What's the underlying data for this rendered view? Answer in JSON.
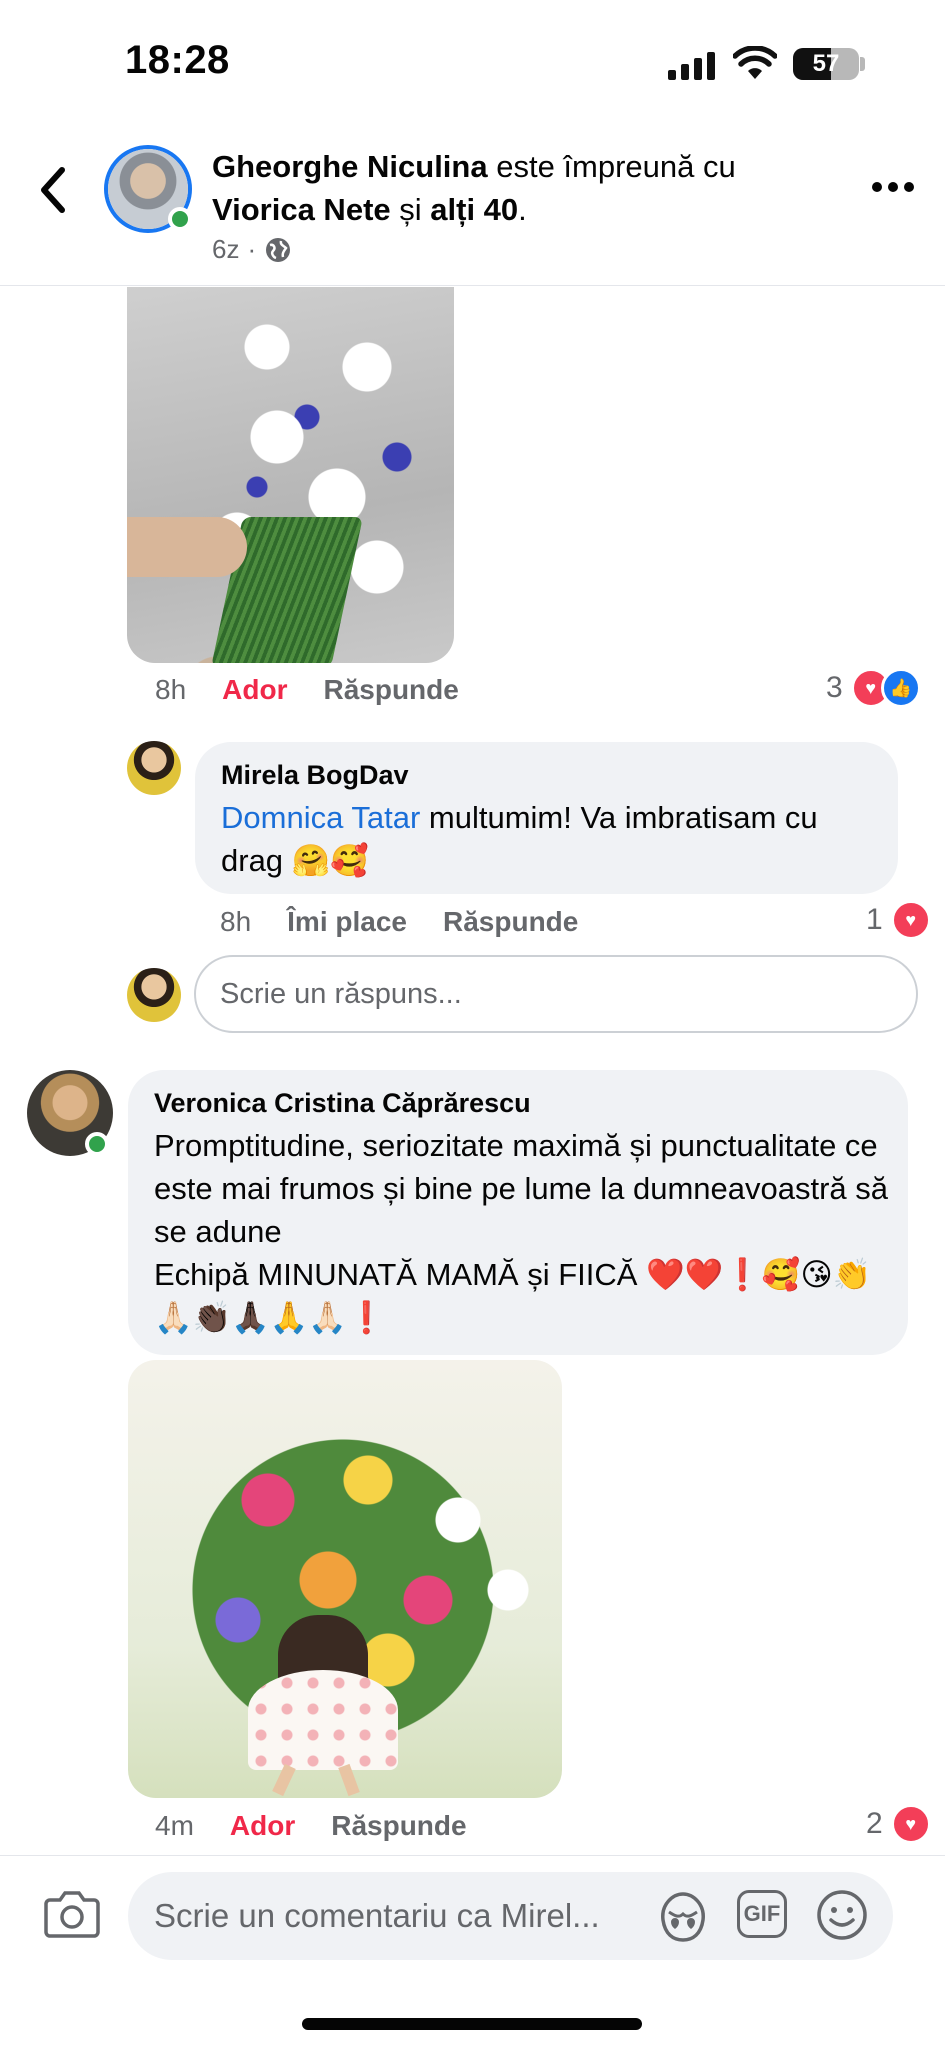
{
  "status_bar": {
    "time": "18:28",
    "battery": "57",
    "battery_level": 0.57
  },
  "header": {
    "author": "Gheorghe Niculina",
    "with_text": " este împreună cu ",
    "tagged": "Viorica Nete",
    "and_text": " și ",
    "others": "alți 40",
    "period": ".",
    "time": "6z",
    "separator": "·"
  },
  "comments": [
    {
      "time": "8h",
      "reaction_label": "Ador",
      "reply_label": "Răspunde",
      "reaction_count": "3"
    },
    {
      "author": "Mirela BogDav",
      "mention": "Domnica Tatar",
      "text": " multumim! Va imbratisam cu drag 🤗🥰",
      "time": "8h",
      "like_label": "Îmi place",
      "reply_label": "Răspunde",
      "reaction_count": "1"
    },
    {
      "author": "Veronica Cristina Căprărescu",
      "text_line1": "Promptitudine, seriozitate  maximă și punctualitate ce este mai frumos și bine pe lume la dumneavoastră să se adune",
      "text_line2": "Echipă MINUNATĂ MAMĂ și FIICĂ ❤️❤️❗🥰😘👏🙏🏻👏🏿🙏🏿🙏🙏🏻❗",
      "time": "4m",
      "reaction_label": "Ador",
      "reply_label": "Răspunde",
      "reaction_count": "2"
    }
  ],
  "reply_box": {
    "placeholder": "Scrie un răspuns..."
  },
  "comment_box": {
    "placeholder": "Scrie un comentariu ca Mirel...",
    "gif_label": "GIF"
  },
  "icons": [
    "back-icon",
    "more-icon",
    "globe-icon",
    "heart-icon",
    "like-icon",
    "camera-icon",
    "avatar-sticker-icon",
    "gif-icon",
    "emoji-icon"
  ],
  "colors": {
    "brand": "#1877f2",
    "love": "#f02849",
    "online": "#31a24c",
    "link": "#1a6ed8"
  }
}
